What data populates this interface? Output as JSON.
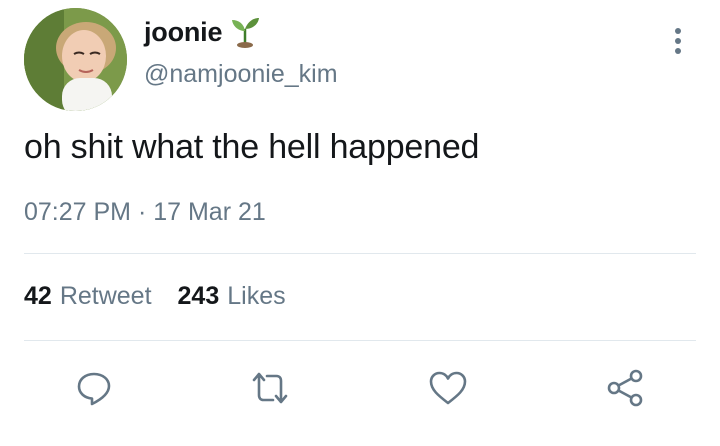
{
  "user": {
    "display_name": "joonie",
    "handle": "@namjoonie_kim",
    "name_emoji": "seedling-icon"
  },
  "tweet": {
    "text": "oh shit what the hell happened",
    "timestamp": "07:27 PM · 17 Mar 21"
  },
  "stats": {
    "retweet_count": "42",
    "retweet_label": "Retweet",
    "likes_count": "243",
    "likes_label": "Likes"
  },
  "actions": [
    "reply-icon",
    "retweet-icon",
    "like-icon",
    "share-icon"
  ],
  "colors": {
    "text": "#14171a",
    "secondary": "#657786",
    "divider": "#e1e8ed",
    "icon": "#657786"
  }
}
